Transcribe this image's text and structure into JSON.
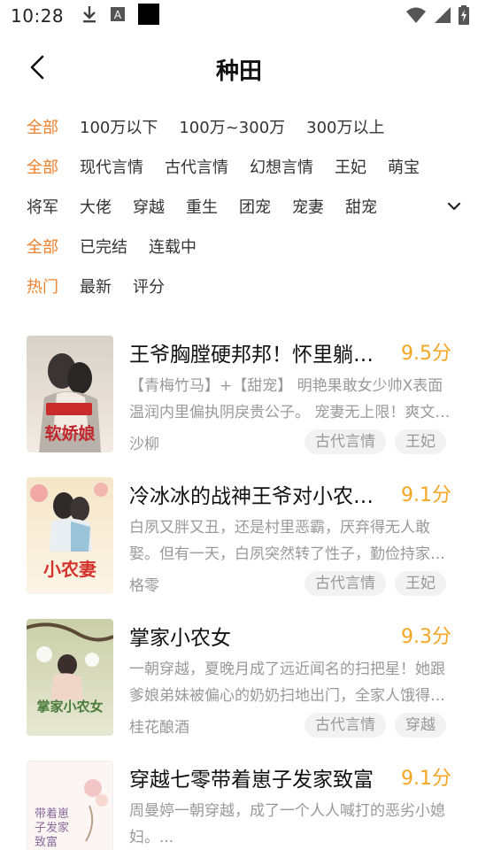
{
  "status_bar": {
    "time": "10:28",
    "icons": [
      "download-icon",
      "a-box-icon",
      "black-square-icon",
      "wifi-icon",
      "signal-icon",
      "battery-charging-icon"
    ]
  },
  "header": {
    "title": "种田",
    "back_icon": "chevron-left-icon"
  },
  "filters": {
    "row1": [
      "全部",
      "100万以下",
      "100万~300万",
      "300万以上"
    ],
    "row2": [
      "全部",
      "现代言情",
      "古代言情",
      "幻想言情",
      "王妃",
      "萌宝"
    ],
    "row3": [
      "将军",
      "大佬",
      "穿越",
      "重生",
      "团宠",
      "宠妻",
      "甜宠"
    ],
    "row4": [
      "全部",
      "已完结",
      "连载中"
    ],
    "row5": [
      "热门",
      "最新",
      "评分"
    ],
    "expand_icon": "chevron-down-icon",
    "accent_color": "#ee7f2a"
  },
  "books": [
    {
      "title": "王爷胸膛硬邦邦！怀里躺着小娇娘",
      "score": "9.5分",
      "desc": "【青梅竹马】+【甜宠】 明艳果敢女少帅X表面温润内里偏执阴戾贵公子。 宠妻无上限！爽文甜宠",
      "author": "沙柳",
      "tags": [
        "古代言情",
        "王妃"
      ],
      "cover_text": "软娇娘"
    },
    {
      "title": "冷冰冰的战神王爷对小农妻动心了",
      "score": "9.1分",
      "desc": "白夙又胖又丑，还是村里恶霸，厌弃得无人敢娶。但有一天，白夙突然转了性子，勤俭持家还貌美如花",
      "author": "格零",
      "tags": [
        "古代言情",
        "王妃"
      ],
      "cover_text": "小农妻"
    },
    {
      "title": "掌家小农女",
      "score": "9.3分",
      "desc": "一朝穿越，夏晚月成了远近闻名的扫把星！她跟爹娘弟妹被偏心的奶奶扫地出门，全家人饿得面黄肌瘦",
      "author": "桂花酿酒",
      "tags": [
        "古代言情",
        "穿越"
      ],
      "cover_text": "掌家小农女"
    },
    {
      "title": "穿越七零带着崽子发家致富",
      "score": "9.1分",
      "desc": "周曼婷一朝穿越，成了一个人人喊打的恶劣小媳妇。...",
      "author": "",
      "tags": [],
      "cover_text": "带着崽子发家致富"
    }
  ]
}
